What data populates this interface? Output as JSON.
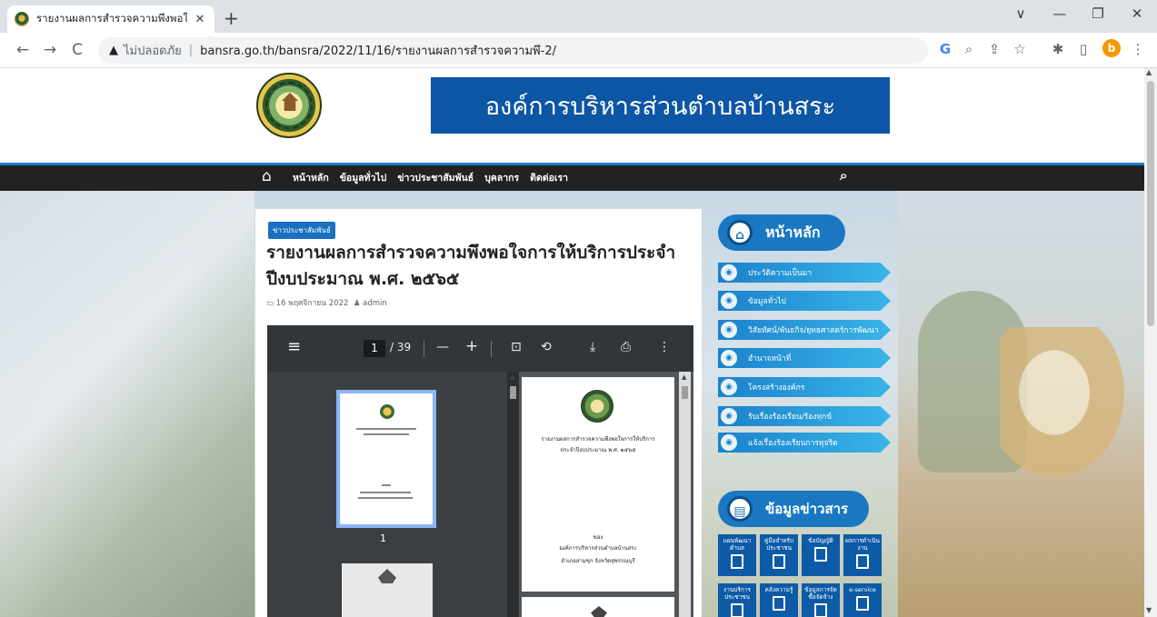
{
  "browser": {
    "tab_title": "รายงานผลการสำรวจความพึงพอใจการ",
    "tab_close": "✕",
    "new_tab": "+",
    "window_minimize": "—",
    "window_restore": "❐",
    "window_close": "✕",
    "window_dropdown": "∨",
    "back": "←",
    "forward": "→",
    "reload": "C",
    "security_label": "ไม่ปลอดภัย",
    "url_separator": "|",
    "url": "bansra.go.th/bansra/2022/11/16/รายงานผลการสำรวจความพึ-2/",
    "profile_initial": "b",
    "toolbar_icons": [
      "G",
      "⌕",
      "⇪",
      "☆",
      "✱",
      "▯",
      "⋮"
    ]
  },
  "site": {
    "org_name": "องค์การบริหารส่วนตำบลบ้านสระ",
    "menu": {
      "home_icon": "⌂",
      "items": [
        "หน้าหลัก",
        "ข้อมูลทั่วไป",
        "ข่าวประชาสัมพันธ์",
        "บุคลากร",
        "ติดต่อเรา"
      ],
      "search_icon": "⌕"
    }
  },
  "post": {
    "category": "ข่าวประชาสัมพันธ์",
    "title": "รายงานผลการสำรวจความพึงพอใจการให้บริการประจำปีงบประมาณ พ.ศ. ๒๕๖๕",
    "date": "16 พฤศจิกายน 2022",
    "author": "admin"
  },
  "pdf": {
    "menu_icon": "≡",
    "current_page": "1",
    "total_pages": "/ 39",
    "zoom_out": "—",
    "zoom_in": "+",
    "fit_icon": "⊡",
    "rotate_icon": "⟲",
    "download_icon": "⤓",
    "print_icon": "⎙",
    "more_icon": "⋮",
    "thumbnail_page_number": "1",
    "page_title_line1": "รายงานผลการสำรวจความพึงพอใจการให้บริการ",
    "page_title_line2": "ประจำปีงบประมาณ พ.ศ. ๒๕๖๕",
    "page_by": "ของ",
    "page_org": "องค์การบริหารส่วนตำบลบ้านสระ",
    "page_location": "อำเภอสามชุก จังหวัดสุพรรณบุรี"
  },
  "sidebar": {
    "home_heading": "หน้าหลัก",
    "links": [
      {
        "label": "ประวัติความเป็นมา",
        "icon": "◉"
      },
      {
        "label": "ข้อมูลทั่วไป",
        "icon": "◉"
      },
      {
        "label": "วิสัยทัศน์/พันธกิจ/ยุทธศาสตร์การพัฒนา",
        "icon": "◉"
      },
      {
        "label": "อำนาจหน้าที่",
        "icon": "◉"
      },
      {
        "label": "โครงสร้างองค์กร",
        "icon": "◉"
      },
      {
        "label": "รับเรื่องร้องเรียน/ร้องทุกข์",
        "icon": "◉"
      },
      {
        "label": "แจ้งเรื่องร้องเรียนการทุจริต",
        "icon": "◉"
      }
    ],
    "news_heading": "ข้อมูลข่าวสาร",
    "tiles_row1": [
      "แผนพัฒนาตำบล",
      "คู่มือสำหรับประชาชน",
      "ข้อบัญญัติ",
      "ผลการดำเนินงาน"
    ],
    "tiles_row2": [
      "งานบริการประชาชน",
      "คลังความรู้",
      "ข้อมูลการจัดซื้อจัดจ้าง",
      "e-service"
    ]
  },
  "colors": {
    "banner": "#0d55a5",
    "menubar": "#222222",
    "accent": "#1a78c2"
  }
}
